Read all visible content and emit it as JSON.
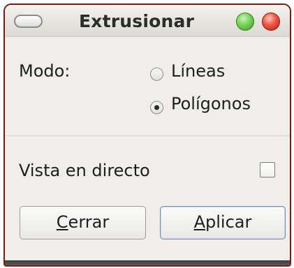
{
  "window": {
    "title": "Extrusionar"
  },
  "mode": {
    "label": "Modo:",
    "options": [
      {
        "label": "Líneas",
        "selected": false
      },
      {
        "label": "Polígonos",
        "selected": true
      }
    ]
  },
  "live_view": {
    "label": "Vista en directo",
    "checked": false
  },
  "buttons": {
    "cerrar": {
      "mnemonic": "C",
      "rest": "errar"
    },
    "aplicar": {
      "mnemonic": "A",
      "rest": "plicar"
    }
  },
  "colors": {
    "window_border": "#7a1c10",
    "background": "#efeeea",
    "maximize_button": "#5bbf3c",
    "close_button": "#e03d2c",
    "default_button_border": "#6f8fb1"
  }
}
